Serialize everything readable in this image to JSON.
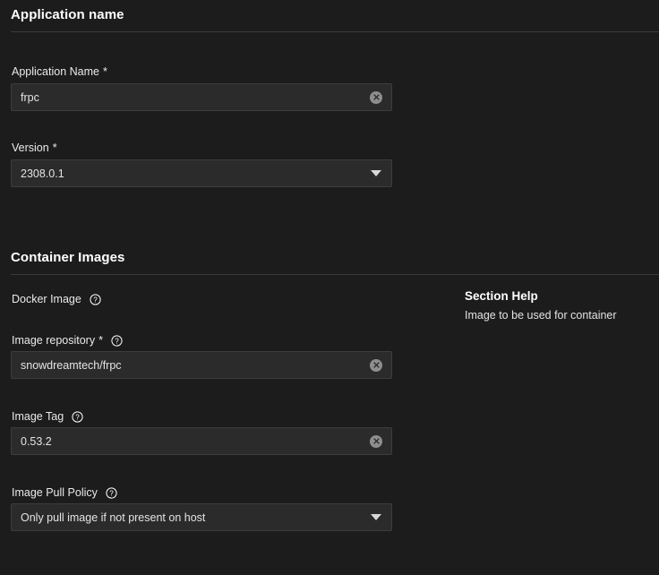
{
  "sections": [
    {
      "title": "Application name",
      "fields": [
        {
          "label": "Application Name",
          "required_marker": "*",
          "type": "text",
          "value": "frpc",
          "has_clear": true,
          "has_help": false
        },
        {
          "label": "Version",
          "required_marker": "*",
          "type": "select",
          "value": "2308.0.1",
          "has_clear": false,
          "has_help": false
        }
      ]
    },
    {
      "title": "Container Images",
      "group_label": "Docker Image",
      "fields": [
        {
          "label": "Image repository",
          "required_marker": "*",
          "type": "text",
          "value": "snowdreamtech/frpc",
          "has_clear": true,
          "has_help": true
        },
        {
          "label": "Image Tag",
          "required_marker": "",
          "type": "text",
          "value": "0.53.2",
          "has_clear": true,
          "has_help": true
        },
        {
          "label": "Image Pull Policy",
          "required_marker": "",
          "type": "select",
          "value": "Only pull image if not present on host",
          "has_clear": false,
          "has_help": true
        }
      ]
    }
  ],
  "help_panel": {
    "title": "Section Help",
    "text": "Image to be used for container"
  },
  "icons": {
    "help": "question-circle-icon",
    "clear": "clear-circle-icon",
    "dropdown": "chevron-down-icon"
  },
  "colors": {
    "page_background": "#1c1c1c",
    "control_background": "#2b2b2b",
    "control_border": "#3d3d3d",
    "divider": "#3a3a3a",
    "text_primary": "#f0f0f0",
    "clear_icon": "#8e8e8e"
  }
}
